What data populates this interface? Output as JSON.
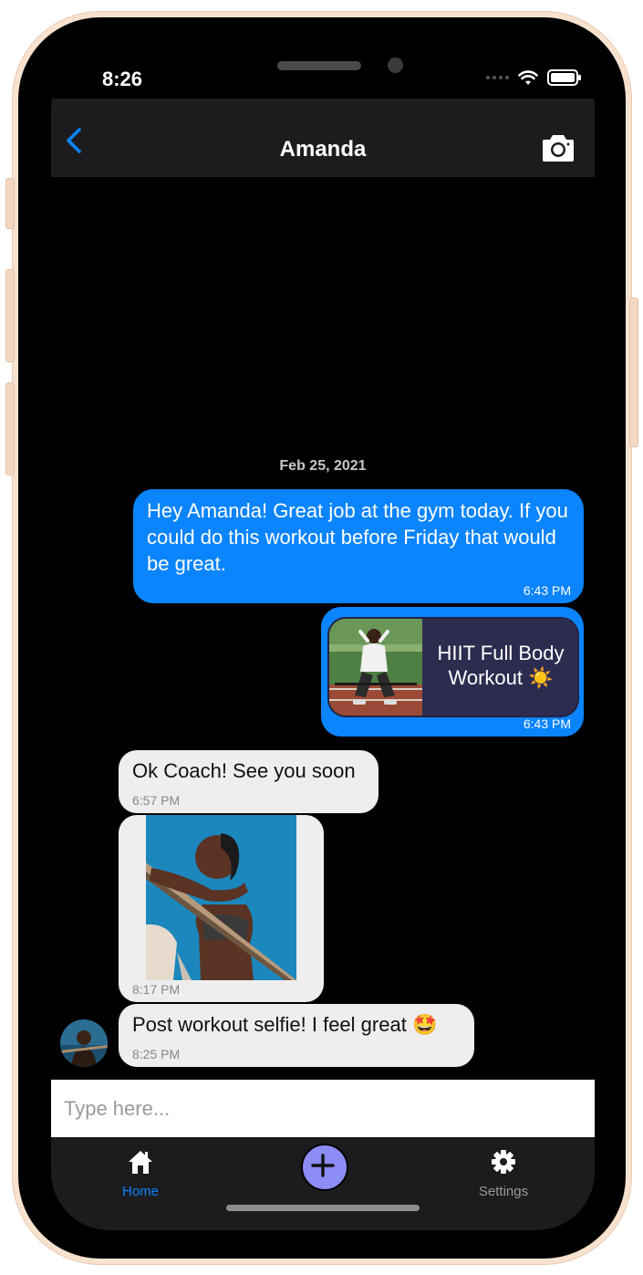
{
  "status_bar": {
    "time": "8:26"
  },
  "header": {
    "title": "Amanda",
    "back_icon": "chevron-left-icon",
    "camera_icon": "camera-icon"
  },
  "thread": {
    "date": "Feb 25, 2021",
    "messages": [
      {
        "direction": "outgoing",
        "type": "text",
        "text": "Hey Amanda! Great job at the gym today.  If you could do this workout before Friday that would be great.",
        "time": "6:43 PM"
      },
      {
        "direction": "outgoing",
        "type": "workout-card",
        "card_title": "HIIT Full Body Workout",
        "card_emoji": "☀️",
        "time": "6:43 PM"
      },
      {
        "direction": "incoming",
        "type": "text",
        "text": "Ok Coach! See you soon",
        "time": "6:57 PM"
      },
      {
        "direction": "incoming",
        "type": "photo",
        "time": "8:17 PM"
      },
      {
        "direction": "incoming",
        "type": "text",
        "text": "Post workout selfie! I feel great",
        "emoji": "🤩",
        "time": "8:25 PM"
      }
    ]
  },
  "composer": {
    "placeholder": "Type here..."
  },
  "tab_bar": {
    "items": [
      {
        "label": "Home",
        "icon": "home-icon",
        "active": true
      },
      {
        "label": "",
        "icon": "plus-icon",
        "active": false
      },
      {
        "label": "Settings",
        "icon": "gear-icon",
        "active": false
      }
    ]
  },
  "colors": {
    "accent": "#0a84ff",
    "incoming_bubble": "#eeeeee",
    "card_background": "#2c2c50",
    "plus_button": "#8c8cf5",
    "tab_active": "#0a84ff",
    "tab_inactive": "#9a9a9a",
    "phone_frame": "#f7e2cf"
  }
}
